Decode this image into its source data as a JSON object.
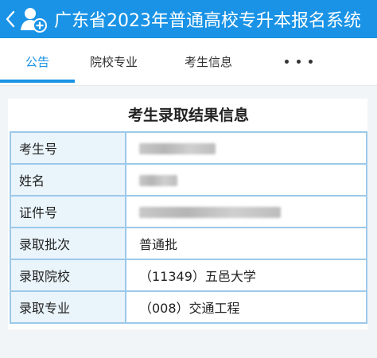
{
  "header": {
    "title": "广东省2023年普通高校专升本报名系统",
    "color": "#1a93e6"
  },
  "tabs": [
    {
      "label": "公告",
      "active": true
    },
    {
      "label": "院校专业",
      "active": false
    },
    {
      "label": "考生信息",
      "active": false
    }
  ],
  "more_icon": "more-dots-icon",
  "result": {
    "title": "考生录取结果信息",
    "rows": [
      {
        "label": "考生号",
        "value": "",
        "redacted": true
      },
      {
        "label": "姓名",
        "value": "",
        "redacted": true
      },
      {
        "label": "证件号",
        "value": "",
        "redacted": true
      },
      {
        "label": "录取批次",
        "value": "普通批"
      },
      {
        "label": "录取院校",
        "value": "（11349）五邑大学"
      },
      {
        "label": "录取专业",
        "value": "（008）交通工程"
      }
    ]
  }
}
